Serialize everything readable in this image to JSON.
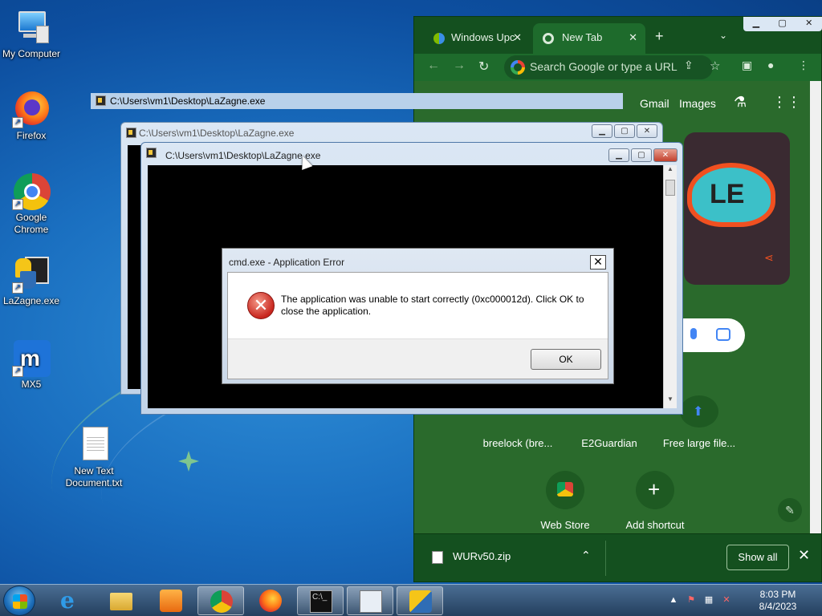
{
  "desktop": {
    "icons": [
      {
        "label": "My Computer",
        "icon": "computer-icon"
      },
      {
        "label": "Firefox",
        "icon": "firefox-icon"
      },
      {
        "label": "Google Chrome",
        "icon": "chrome-icon"
      },
      {
        "label": "LaZagne.exe",
        "icon": "python-exe-icon"
      },
      {
        "label": "MX5",
        "icon": "maxthon-icon"
      },
      {
        "label": "New Text Document.txt",
        "icon": "text-file-icon"
      }
    ]
  },
  "chrome": {
    "tabs": [
      {
        "label": "Windows Upc",
        "icon": "windows-update-icon"
      },
      {
        "label": "New Tab",
        "icon": "chrome-icon"
      }
    ],
    "new_tab_symbol": "+",
    "omnibox_placeholder": "Search Google or type a URL",
    "header_links": [
      "Gmail",
      "Images"
    ],
    "shortcuts": [
      {
        "label": "breelock (bre..."
      },
      {
        "label": "E2Guardian"
      },
      {
        "label": "Free large file..."
      },
      {
        "label": "Web Store"
      },
      {
        "label": "Add shortcut"
      }
    ],
    "download": {
      "file": "WURv50.zip",
      "show_all": "Show all"
    }
  },
  "console_back": {
    "title": "C:\\Users\\vm1\\Desktop\\LaZagne.exe"
  },
  "console_mid": {
    "title": "C:\\Users\\vm1\\Desktop\\LaZagne.exe"
  },
  "console_front": {
    "title": "C:\\Users\\vm1\\Desktop\\LaZagne.exe"
  },
  "error_dialog": {
    "title": "cmd.exe - Application Error",
    "message": "The application was unable to start correctly (0xc000012d). Click OK to close the application.",
    "ok_label": "OK"
  },
  "taskbar": {
    "items": [
      "internet-explorer-icon",
      "explorer-icon",
      "media-player-icon",
      "chrome-icon",
      "firefox-icon",
      "cmd-icon",
      "window-icon",
      "lazagne-icon"
    ],
    "time": "8:03 PM",
    "date": "8/4/2023"
  },
  "colors": {
    "chrome_frame": "#14501f",
    "chrome_toolbar": "#1e6b2c",
    "win7_title": "#c1d3e8",
    "error_red": "#c8261e"
  }
}
